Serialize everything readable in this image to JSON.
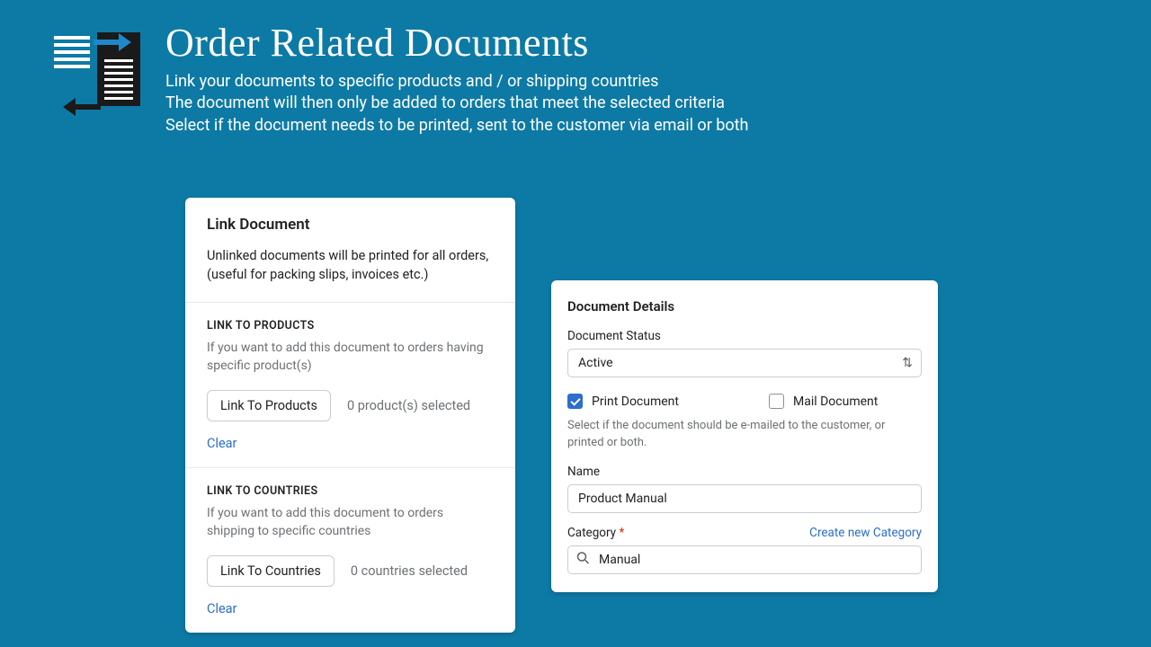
{
  "header": {
    "title": "Order Related Documents",
    "sub1": "Link your documents to specific products and / or shipping countries",
    "sub2": "The document will then only be added to orders that meet the selected criteria",
    "sub3": "Select if the document needs to be printed, sent to the customer via email or both"
  },
  "link_card": {
    "title": "Link Document",
    "intro": "Unlinked documents will be printed for all orders, (useful for packing slips, invoices etc.)",
    "products": {
      "label": "LINK TO PRODUCTS",
      "desc": "If you want to add this document to orders having specific product(s)",
      "button": "Link To Products",
      "status": "0 product(s) selected",
      "clear": "Clear"
    },
    "countries": {
      "label": "LINK TO COUNTRIES",
      "desc": "If you want to add this document to orders shipping to specific countries",
      "button": "Link To Countries",
      "status": "0 countries selected",
      "clear": "Clear"
    }
  },
  "details": {
    "title": "Document Details",
    "status_label": "Document Status",
    "status_value": "Active",
    "print_label": "Print Document",
    "print_checked": true,
    "mail_label": "Mail Document",
    "mail_checked": false,
    "help": "Select if the document should be e-mailed to the customer, or printed or both.",
    "name_label": "Name",
    "name_value": "Product Manual",
    "category_label": "Category",
    "create_category": "Create new Category",
    "category_value": "Manual"
  }
}
